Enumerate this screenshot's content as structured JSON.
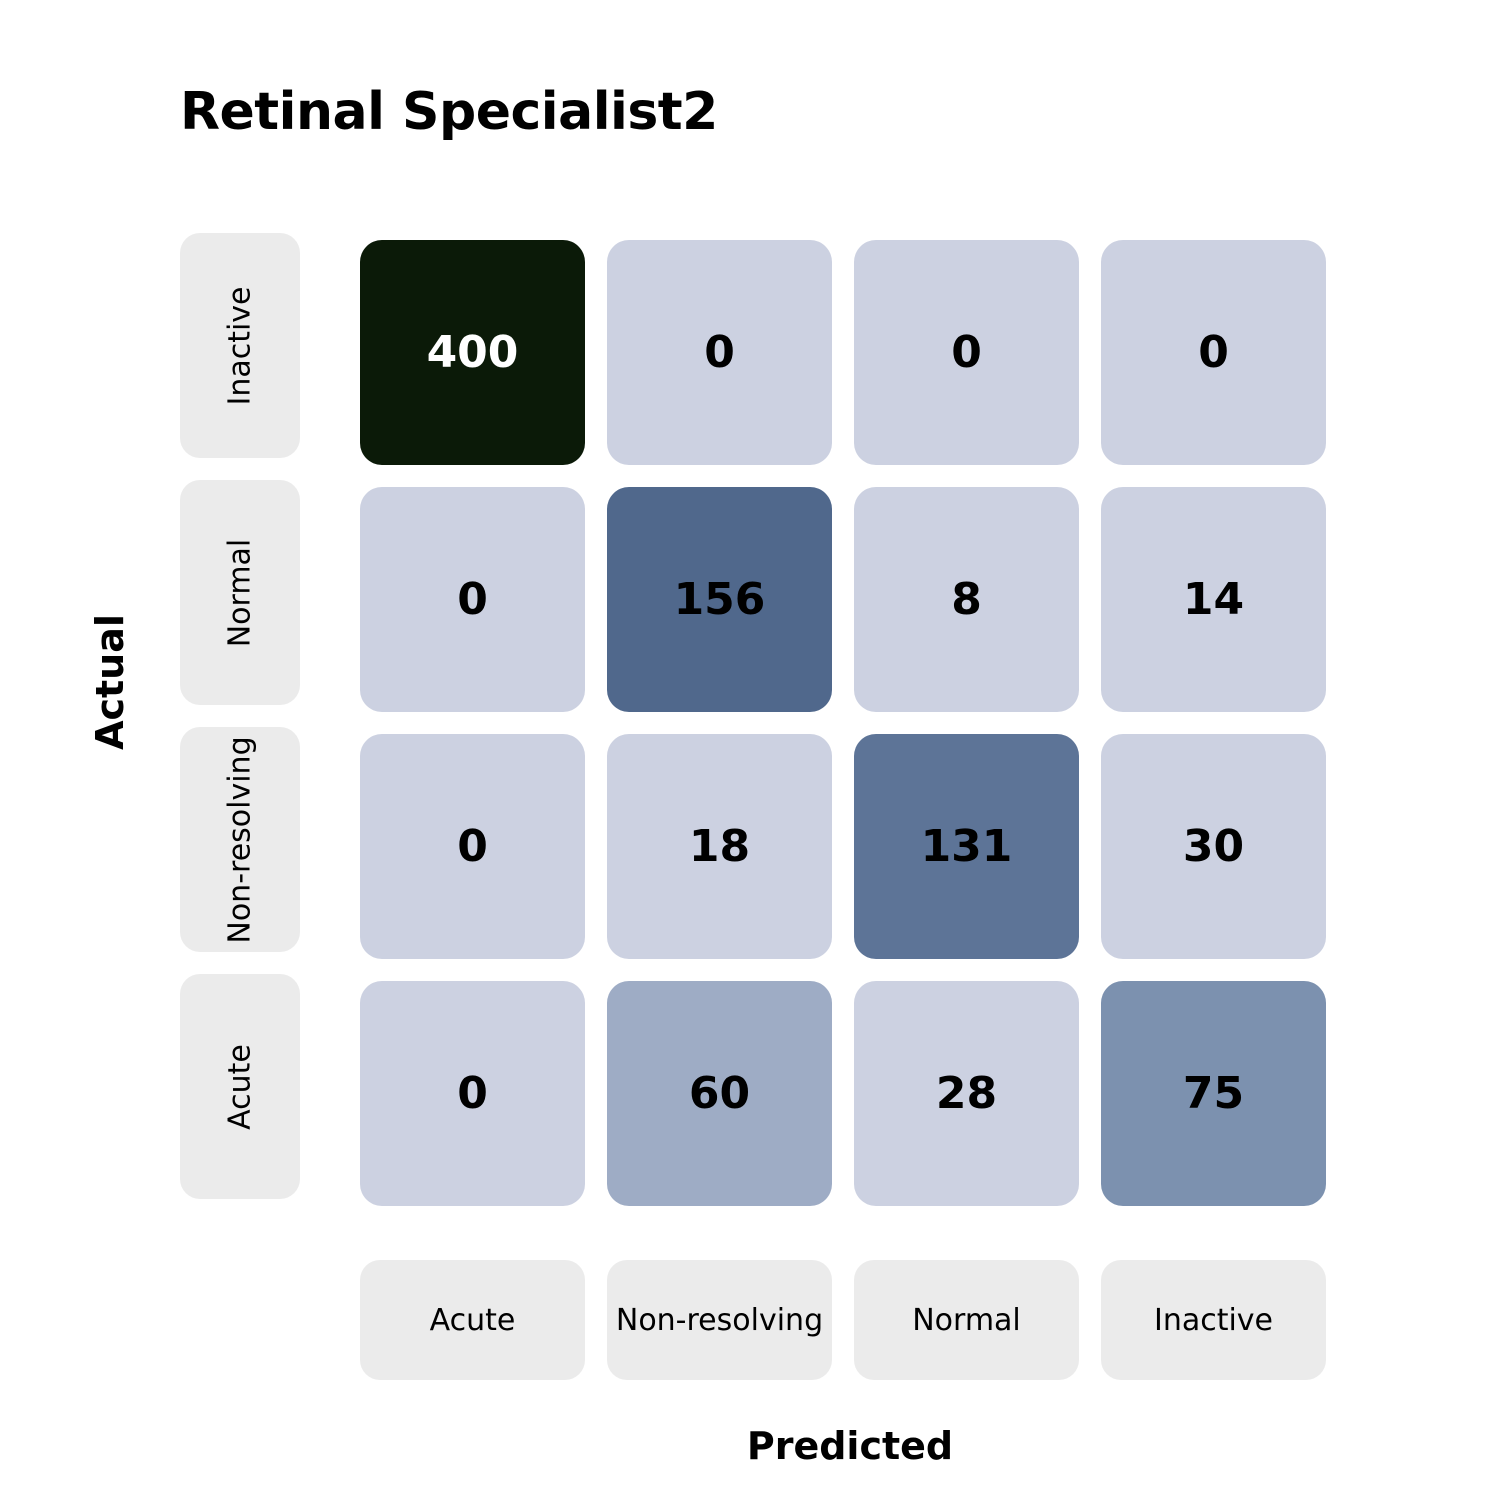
{
  "chart_data": {
    "type": "heatmap",
    "title": "Retinal Specialist2",
    "xlabel": "Predicted",
    "ylabel": "Actual",
    "x_categories": [
      "Acute",
      "Non-resolving",
      "Normal",
      "Inactive"
    ],
    "y_categories_top_to_bottom": [
      "Inactive",
      "Normal",
      "Non-resolving",
      "Acute"
    ],
    "matrix_top_to_bottom": [
      [
        400,
        0,
        0,
        0
      ],
      [
        0,
        156,
        8,
        14
      ],
      [
        0,
        18,
        131,
        30
      ],
      [
        0,
        60,
        28,
        75
      ]
    ],
    "color_scale": {
      "low": "#ccd1e1",
      "mid": "#7a8fae",
      "high_mid": "#50688c",
      "max": "#0b1a08"
    }
  }
}
